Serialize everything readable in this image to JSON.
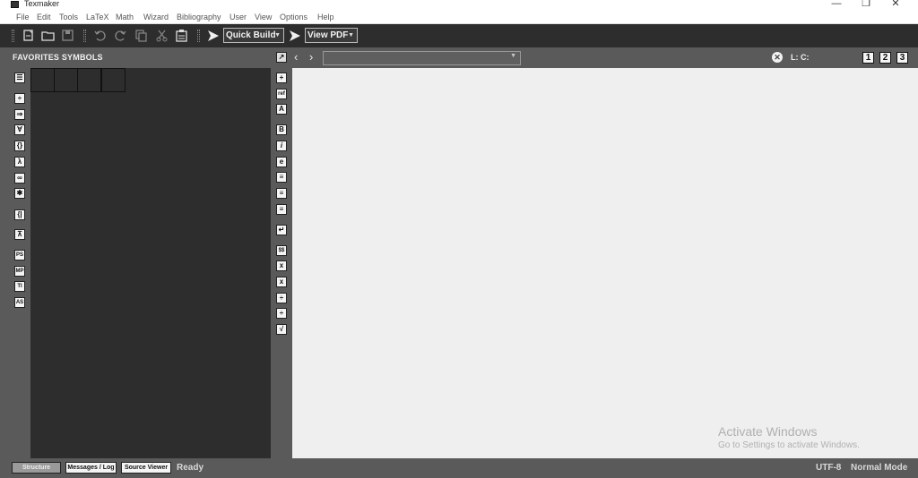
{
  "window": {
    "title": "Texmaker",
    "minimize_glyph": "—",
    "maximize_glyph": "❐",
    "close_glyph": "✕"
  },
  "menu": [
    "File",
    "Edit",
    "Tools",
    "LaTeX",
    "Math",
    "Wizard",
    "Bibliography",
    "User",
    "View",
    "Options",
    "Help"
  ],
  "toolbar": {
    "quick_build": "Quick Build",
    "view_pdf": "View PDF",
    "icons": [
      "new-file-icon",
      "open-folder-icon",
      "save-icon",
      "undo-icon",
      "redo-icon",
      "copy-icon",
      "cut-icon",
      "paste-icon",
      "run-icon"
    ]
  },
  "left_panel": {
    "title": "FAVORITES SYMBOLS",
    "icons": [
      {
        "name": "structure-icon",
        "glyph": "☰"
      },
      {
        "name": "relation-icon",
        "glyph": "÷"
      },
      {
        "name": "arrows-icon",
        "glyph": "⇒"
      },
      {
        "name": "misc-math-icon",
        "glyph": "∀"
      },
      {
        "name": "delimiters-icon",
        "glyph": "{}"
      },
      {
        "name": "greek-icon",
        "glyph": "λ"
      },
      {
        "name": "most-used-icon",
        "glyph": "∞"
      },
      {
        "name": "favorites-icon",
        "glyph": "✱"
      },
      {
        "name": "left-right-icon",
        "glyph": "{|"
      },
      {
        "name": "user-symbol-icon",
        "glyph": "⊼"
      },
      {
        "name": "pstricks-icon",
        "glyph": "PS"
      },
      {
        "name": "metapost-icon",
        "glyph": "MP"
      },
      {
        "name": "tikz-icon",
        "glyph": "TI"
      },
      {
        "name": "asymptote-icon",
        "glyph": "AS"
      }
    ]
  },
  "middle_bar": {
    "icons": [
      {
        "name": "add-icon",
        "glyph": "+"
      },
      {
        "name": "ref-icon",
        "glyph": "ref"
      },
      {
        "name": "font-size-icon",
        "glyph": "A"
      },
      {
        "name": "bold-icon",
        "glyph": "B"
      },
      {
        "name": "italic-icon",
        "glyph": "i"
      },
      {
        "name": "emphasis-icon",
        "glyph": "e"
      },
      {
        "name": "align-left-icon",
        "glyph": "≡"
      },
      {
        "name": "align-center-icon",
        "glyph": "≡"
      },
      {
        "name": "align-right-icon",
        "glyph": "≡"
      },
      {
        "name": "newline-icon",
        "glyph": "↵"
      },
      {
        "name": "math-mode-icon",
        "glyph": "$$"
      },
      {
        "name": "subscript-icon",
        "glyph": "x"
      },
      {
        "name": "superscript-icon",
        "glyph": "x"
      },
      {
        "name": "fraction-icon",
        "glyph": "÷"
      },
      {
        "name": "dfrac-icon",
        "glyph": "÷"
      },
      {
        "name": "sqrt-icon",
        "glyph": "√"
      }
    ]
  },
  "editor_header": {
    "line_col": "L: C:",
    "view_buttons": [
      "1",
      "2",
      "3"
    ],
    "close_glyph": "✕",
    "back_glyph": "‹",
    "forward_glyph": "›"
  },
  "watermark": {
    "title": "Activate Windows",
    "subtitle": "Go to Settings to activate Windows."
  },
  "status_bar": {
    "structure": "Structure",
    "messages_log": "Messages / Log",
    "source_viewer": "Source Viewer",
    "status": "Ready",
    "encoding": "UTF-8",
    "mode": "Normal Mode"
  }
}
